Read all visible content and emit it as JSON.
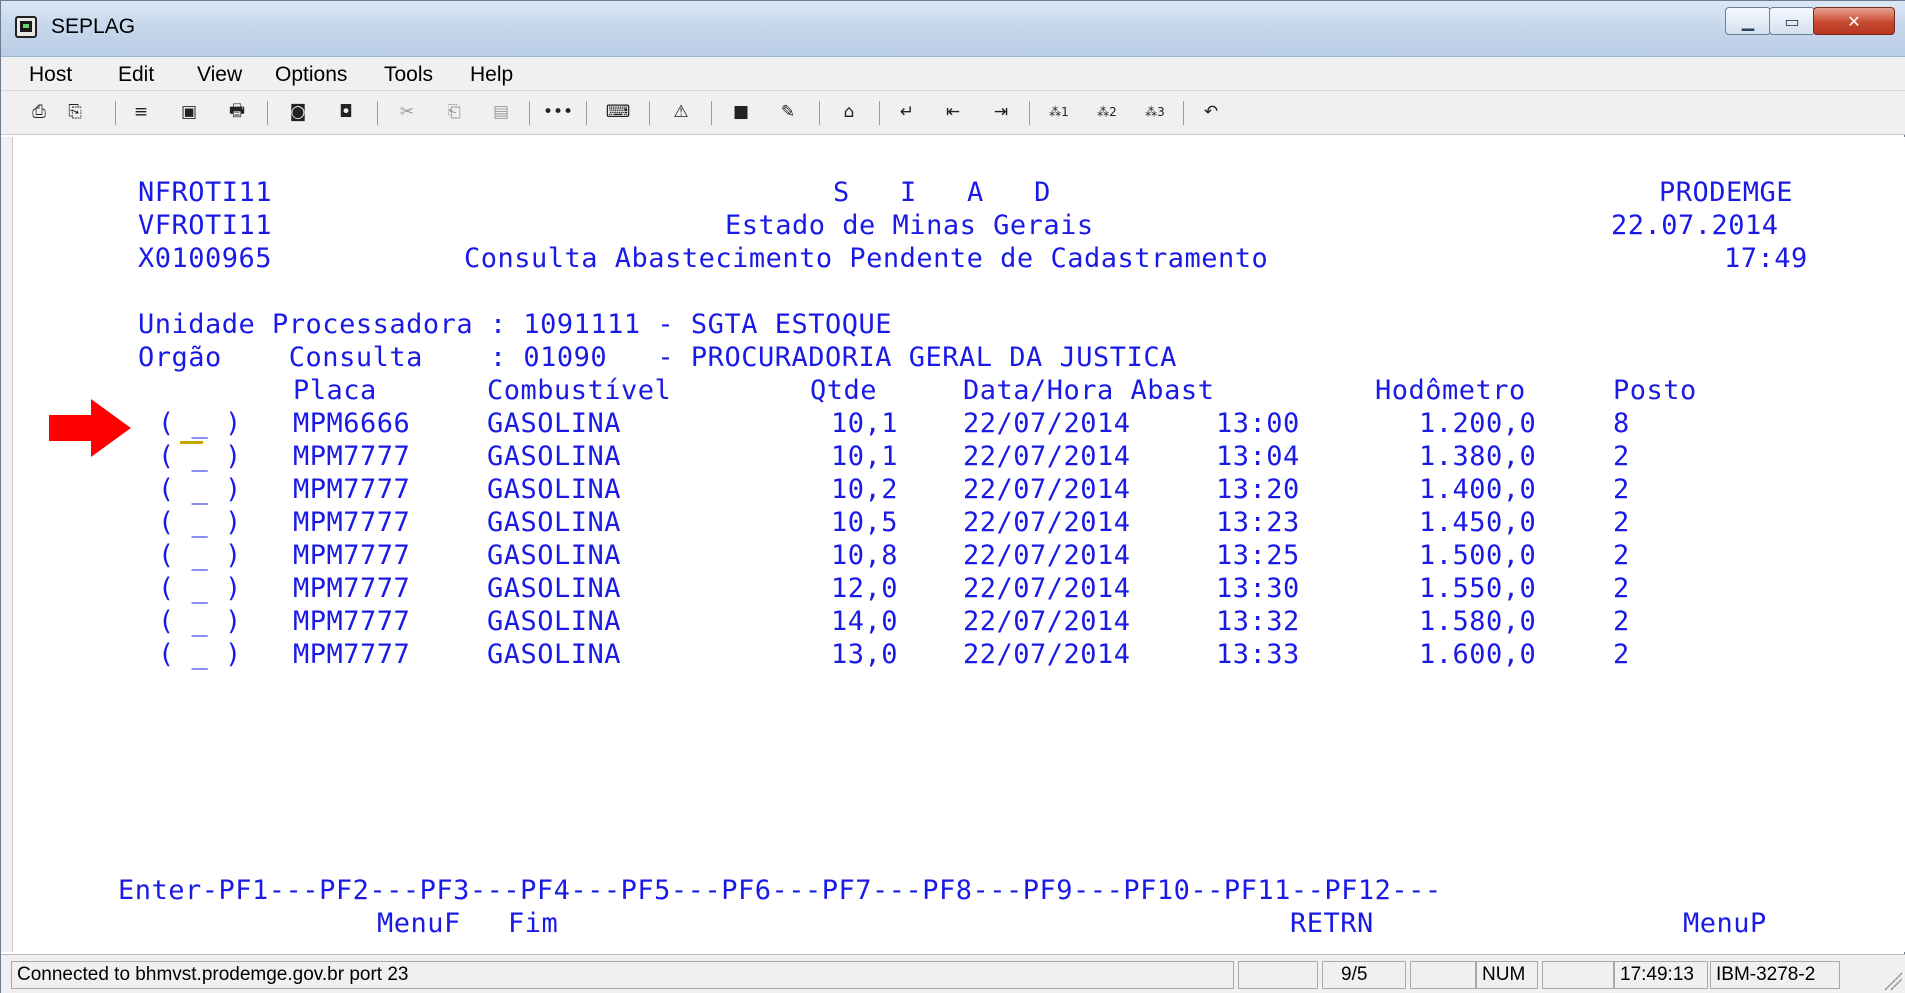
{
  "window": {
    "title": "SEPLAG"
  },
  "menu": [
    "Host",
    "Edit",
    "View",
    "Options",
    "Tools",
    "Help"
  ],
  "toolbar_icons": [
    "print-icon",
    "copy-icon",
    "transfer-icon",
    "screen-icon",
    "print2-icon",
    "cut-icon",
    "paste-icon",
    "clear-icon",
    "dots-icon",
    "macro-icon",
    "warning-icon",
    "keyboard-icon",
    "pencil-icon",
    "home-icon",
    "enter-icon",
    "tab-back-icon",
    "tab-icon",
    "pf1-icon",
    "pf2-icon",
    "pf3-icon",
    "undo-icon"
  ],
  "colors": {
    "terminal_text": "#1a1ae6",
    "arrow": "#ff0000",
    "cursor": "#c9a400"
  },
  "screen": {
    "header": {
      "left": [
        "NFROTI11",
        "VFROTI11",
        "X0100965"
      ],
      "center": [
        "S   I   A   D",
        "Estado de Minas Gerais",
        "Consulta Abastecimento Pendente de Cadastramento"
      ],
      "right": [
        "PRODEMGE",
        "22.07.2014",
        "17:49"
      ]
    },
    "unidade_line": "Unidade Processadora : 1091111 - SGTA ESTOQUE",
    "orgao_line": "Orgão    Consulta    : 01090   - PROCURADORIA GERAL DA JUSTICA",
    "columns": [
      "Placa",
      "Combustível",
      "Qtde",
      "Data/Hora Abast",
      "Hodômetro",
      "Posto"
    ],
    "rows": [
      {
        "sel": "( _ )",
        "placa": "MPM6666",
        "comb": "GASOLINA",
        "qtde": "10,1",
        "data": "22/07/2014",
        "hora": "13:00",
        "hodo": "1.200,0",
        "posto": "8"
      },
      {
        "sel": "( _ )",
        "placa": "MPM7777",
        "comb": "GASOLINA",
        "qtde": "10,1",
        "data": "22/07/2014",
        "hora": "13:04",
        "hodo": "1.380,0",
        "posto": "2"
      },
      {
        "sel": "( _ )",
        "placa": "MPM7777",
        "comb": "GASOLINA",
        "qtde": "10,2",
        "data": "22/07/2014",
        "hora": "13:20",
        "hodo": "1.400,0",
        "posto": "2"
      },
      {
        "sel": "( _ )",
        "placa": "MPM7777",
        "comb": "GASOLINA",
        "qtde": "10,5",
        "data": "22/07/2014",
        "hora": "13:23",
        "hodo": "1.450,0",
        "posto": "2"
      },
      {
        "sel": "( _ )",
        "placa": "MPM7777",
        "comb": "GASOLINA",
        "qtde": "10,8",
        "data": "22/07/2014",
        "hora": "13:25",
        "hodo": "1.500,0",
        "posto": "2"
      },
      {
        "sel": "( _ )",
        "placa": "MPM7777",
        "comb": "GASOLINA",
        "qtde": "12,0",
        "data": "22/07/2014",
        "hora": "13:30",
        "hodo": "1.550,0",
        "posto": "2"
      },
      {
        "sel": "( _ )",
        "placa": "MPM7777",
        "comb": "GASOLINA",
        "qtde": "14,0",
        "data": "22/07/2014",
        "hora": "13:32",
        "hodo": "1.580,0",
        "posto": "2"
      },
      {
        "sel": "( _ )",
        "placa": "MPM7777",
        "comb": "GASOLINA",
        "qtde": "13,0",
        "data": "22/07/2014",
        "hora": "13:33",
        "hodo": "1.600,0",
        "posto": "2"
      }
    ],
    "pf_line": "Enter-PF1---PF2---PF3---PF4---PF5---PF6---PF7---PF8---PF9---PF10--PF11--PF12---",
    "pf_labels": {
      "pf2": "MenuF",
      "pf3": "Fim",
      "pf9": "RETRN",
      "pf12": "MenuP"
    }
  },
  "status": {
    "connection": "Connected to bhmvst.prodemge.gov.br port 23",
    "cursor_pos": "9/5",
    "num": "NUM",
    "time": "17:49:13",
    "terminal_type": "IBM-3278-2"
  }
}
